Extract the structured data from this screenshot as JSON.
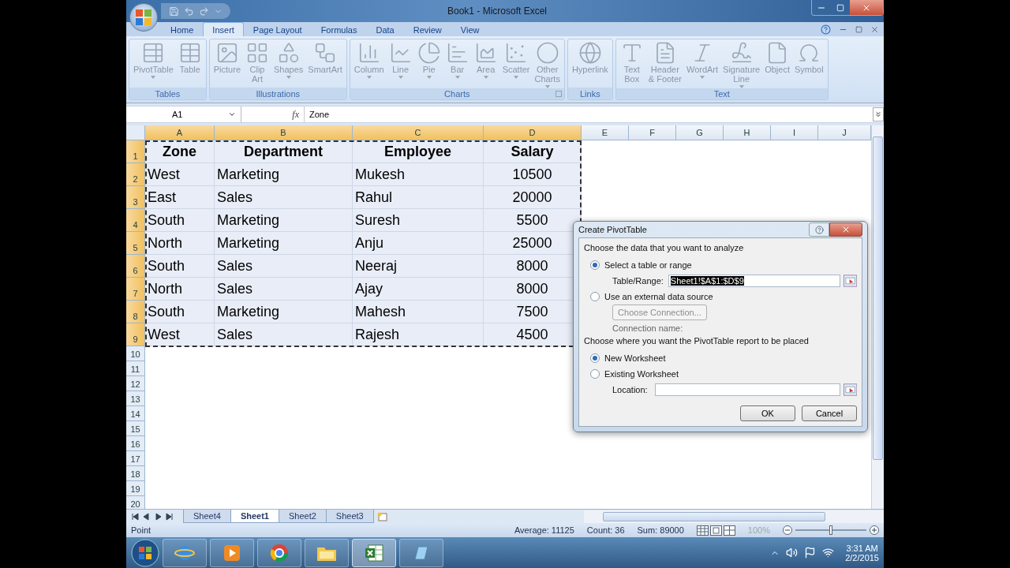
{
  "window": {
    "title": "Book1 - Microsoft Excel"
  },
  "tabs": [
    {
      "label": "Home",
      "selected": false
    },
    {
      "label": "Insert",
      "selected": true
    },
    {
      "label": "Page Layout",
      "selected": false
    },
    {
      "label": "Formulas",
      "selected": false
    },
    {
      "label": "Data",
      "selected": false
    },
    {
      "label": "Review",
      "selected": false
    },
    {
      "label": "View",
      "selected": false
    }
  ],
  "ribbon_groups": [
    {
      "label": "Tables",
      "launcher": false,
      "buttons": [
        {
          "lines": [
            "PivotTable"
          ],
          "dropdown": true
        },
        {
          "lines": [
            "Table"
          ],
          "dropdown": false
        }
      ]
    },
    {
      "label": "Illustrations",
      "launcher": false,
      "buttons": [
        {
          "lines": [
            "Picture"
          ],
          "dropdown": false
        },
        {
          "lines": [
            "Clip",
            "Art"
          ],
          "dropdown": false
        },
        {
          "lines": [
            "Shapes"
          ],
          "dropdown": true
        },
        {
          "lines": [
            "SmartArt"
          ],
          "dropdown": false
        }
      ]
    },
    {
      "label": "Charts",
      "launcher": true,
      "buttons": [
        {
          "lines": [
            "Column"
          ],
          "dropdown": true
        },
        {
          "lines": [
            "Line"
          ],
          "dropdown": true
        },
        {
          "lines": [
            "Pie"
          ],
          "dropdown": true
        },
        {
          "lines": [
            "Bar"
          ],
          "dropdown": true
        },
        {
          "lines": [
            "Area"
          ],
          "dropdown": true
        },
        {
          "lines": [
            "Scatter"
          ],
          "dropdown": true
        },
        {
          "lines": [
            "Other",
            "Charts"
          ],
          "dropdown": true
        }
      ]
    },
    {
      "label": "Links",
      "launcher": false,
      "buttons": [
        {
          "lines": [
            "Hyperlink"
          ],
          "dropdown": false
        }
      ]
    },
    {
      "label": "Text",
      "launcher": false,
      "buttons": [
        {
          "lines": [
            "Text",
            "Box"
          ],
          "dropdown": false
        },
        {
          "lines": [
            "Header",
            "& Footer"
          ],
          "dropdown": false
        },
        {
          "lines": [
            "WordArt"
          ],
          "dropdown": true
        },
        {
          "lines": [
            "Signature",
            "Line"
          ],
          "dropdown": true
        },
        {
          "lines": [
            "Object"
          ],
          "dropdown": false
        },
        {
          "lines": [
            "Symbol"
          ],
          "dropdown": false
        }
      ]
    }
  ],
  "name_box": "A1",
  "function_button": "fx",
  "formula": "Zone",
  "columns": [
    {
      "label": "A",
      "selected": true
    },
    {
      "label": "B",
      "selected": true
    },
    {
      "label": "C",
      "selected": true
    },
    {
      "label": "D",
      "selected": true
    },
    {
      "label": "E",
      "selected": false
    },
    {
      "label": "F",
      "selected": false
    },
    {
      "label": "G",
      "selected": false
    },
    {
      "label": "H",
      "selected": false
    },
    {
      "label": "I",
      "selected": false
    },
    {
      "label": "J",
      "selected": false
    }
  ],
  "rows": [
    {
      "number": "1",
      "selected": true,
      "kind": "header",
      "cells": [
        "Zone",
        "Department",
        "Employee",
        "Salary"
      ]
    },
    {
      "number": "2",
      "selected": true,
      "kind": "data",
      "cells": [
        "West",
        "Marketing",
        "Mukesh",
        "10500"
      ]
    },
    {
      "number": "3",
      "selected": true,
      "kind": "data",
      "cells": [
        "East",
        "Sales",
        "Rahul",
        "20000"
      ]
    },
    {
      "number": "4",
      "selected": true,
      "kind": "data",
      "cells": [
        "South",
        "Marketing",
        "Suresh",
        "5500"
      ]
    },
    {
      "number": "5",
      "selected": true,
      "kind": "data",
      "cells": [
        "North",
        "Marketing",
        "Anju",
        "25000"
      ]
    },
    {
      "number": "6",
      "selected": true,
      "kind": "data",
      "cells": [
        "South",
        "Sales",
        "Neeraj",
        "8000"
      ]
    },
    {
      "number": "7",
      "selected": true,
      "kind": "data",
      "cells": [
        "North",
        "Sales",
        "Ajay",
        "8000"
      ]
    },
    {
      "number": "8",
      "selected": true,
      "kind": "data",
      "cells": [
        "South",
        "Marketing",
        "Mahesh",
        "7500"
      ]
    },
    {
      "number": "9",
      "selected": true,
      "kind": "data",
      "cells": [
        "West",
        "Sales",
        "Rajesh",
        "4500"
      ]
    },
    {
      "number": "10",
      "selected": false,
      "kind": "empty",
      "cells": []
    },
    {
      "number": "11",
      "selected": false,
      "kind": "empty",
      "cells": []
    },
    {
      "number": "12",
      "selected": false,
      "kind": "empty",
      "cells": []
    },
    {
      "number": "13",
      "selected": false,
      "kind": "empty",
      "cells": []
    },
    {
      "number": "14",
      "selected": false,
      "kind": "empty",
      "cells": []
    },
    {
      "number": "15",
      "selected": false,
      "kind": "empty",
      "cells": []
    },
    {
      "number": "16",
      "selected": false,
      "kind": "empty",
      "cells": []
    },
    {
      "number": "17",
      "selected": false,
      "kind": "empty",
      "cells": []
    },
    {
      "number": "18",
      "selected": false,
      "kind": "empty",
      "cells": []
    },
    {
      "number": "19",
      "selected": false,
      "kind": "empty",
      "cells": []
    },
    {
      "number": "20",
      "selected": false,
      "kind": "empty",
      "cells": []
    }
  ],
  "sheet_tabs": [
    {
      "label": "Sheet4",
      "selected": false
    },
    {
      "label": "Sheet1",
      "selected": true
    },
    {
      "label": "Sheet2",
      "selected": false
    },
    {
      "label": "Sheet3",
      "selected": false
    }
  ],
  "status_bar": {
    "mode": "Point",
    "average": "Average: 11125",
    "count": "Count: 36",
    "sum": "Sum: 89000",
    "zoom": "100%",
    "zoom_slider": {
      "level": 0.5
    }
  },
  "taskbar": {
    "time": "3:31 AM",
    "date": "2/2/2015"
  },
  "dialog": {
    "title": "Create PivotTable",
    "section_1": "Choose the data that you want to analyze",
    "option_range": {
      "label": "Select a table or range",
      "selected": true
    },
    "range_label": "Table/Range:",
    "range_value": "Sheet1!$A$1:$D$9",
    "range_value_highlighted": true,
    "option_external": {
      "label": "Use an external data source",
      "selected": false
    },
    "choose_connection": {
      "label": "Choose Connection...",
      "disabled": true
    },
    "connection_name": "Connection name:",
    "section_2": "Choose where you want the PivotTable report to be placed",
    "option_new": {
      "label": "New Worksheet",
      "selected": true
    },
    "option_existing": {
      "label": "Existing Worksheet",
      "selected": false
    },
    "location_label": "Location:",
    "ok": "OK",
    "cancel": "Cancel"
  }
}
